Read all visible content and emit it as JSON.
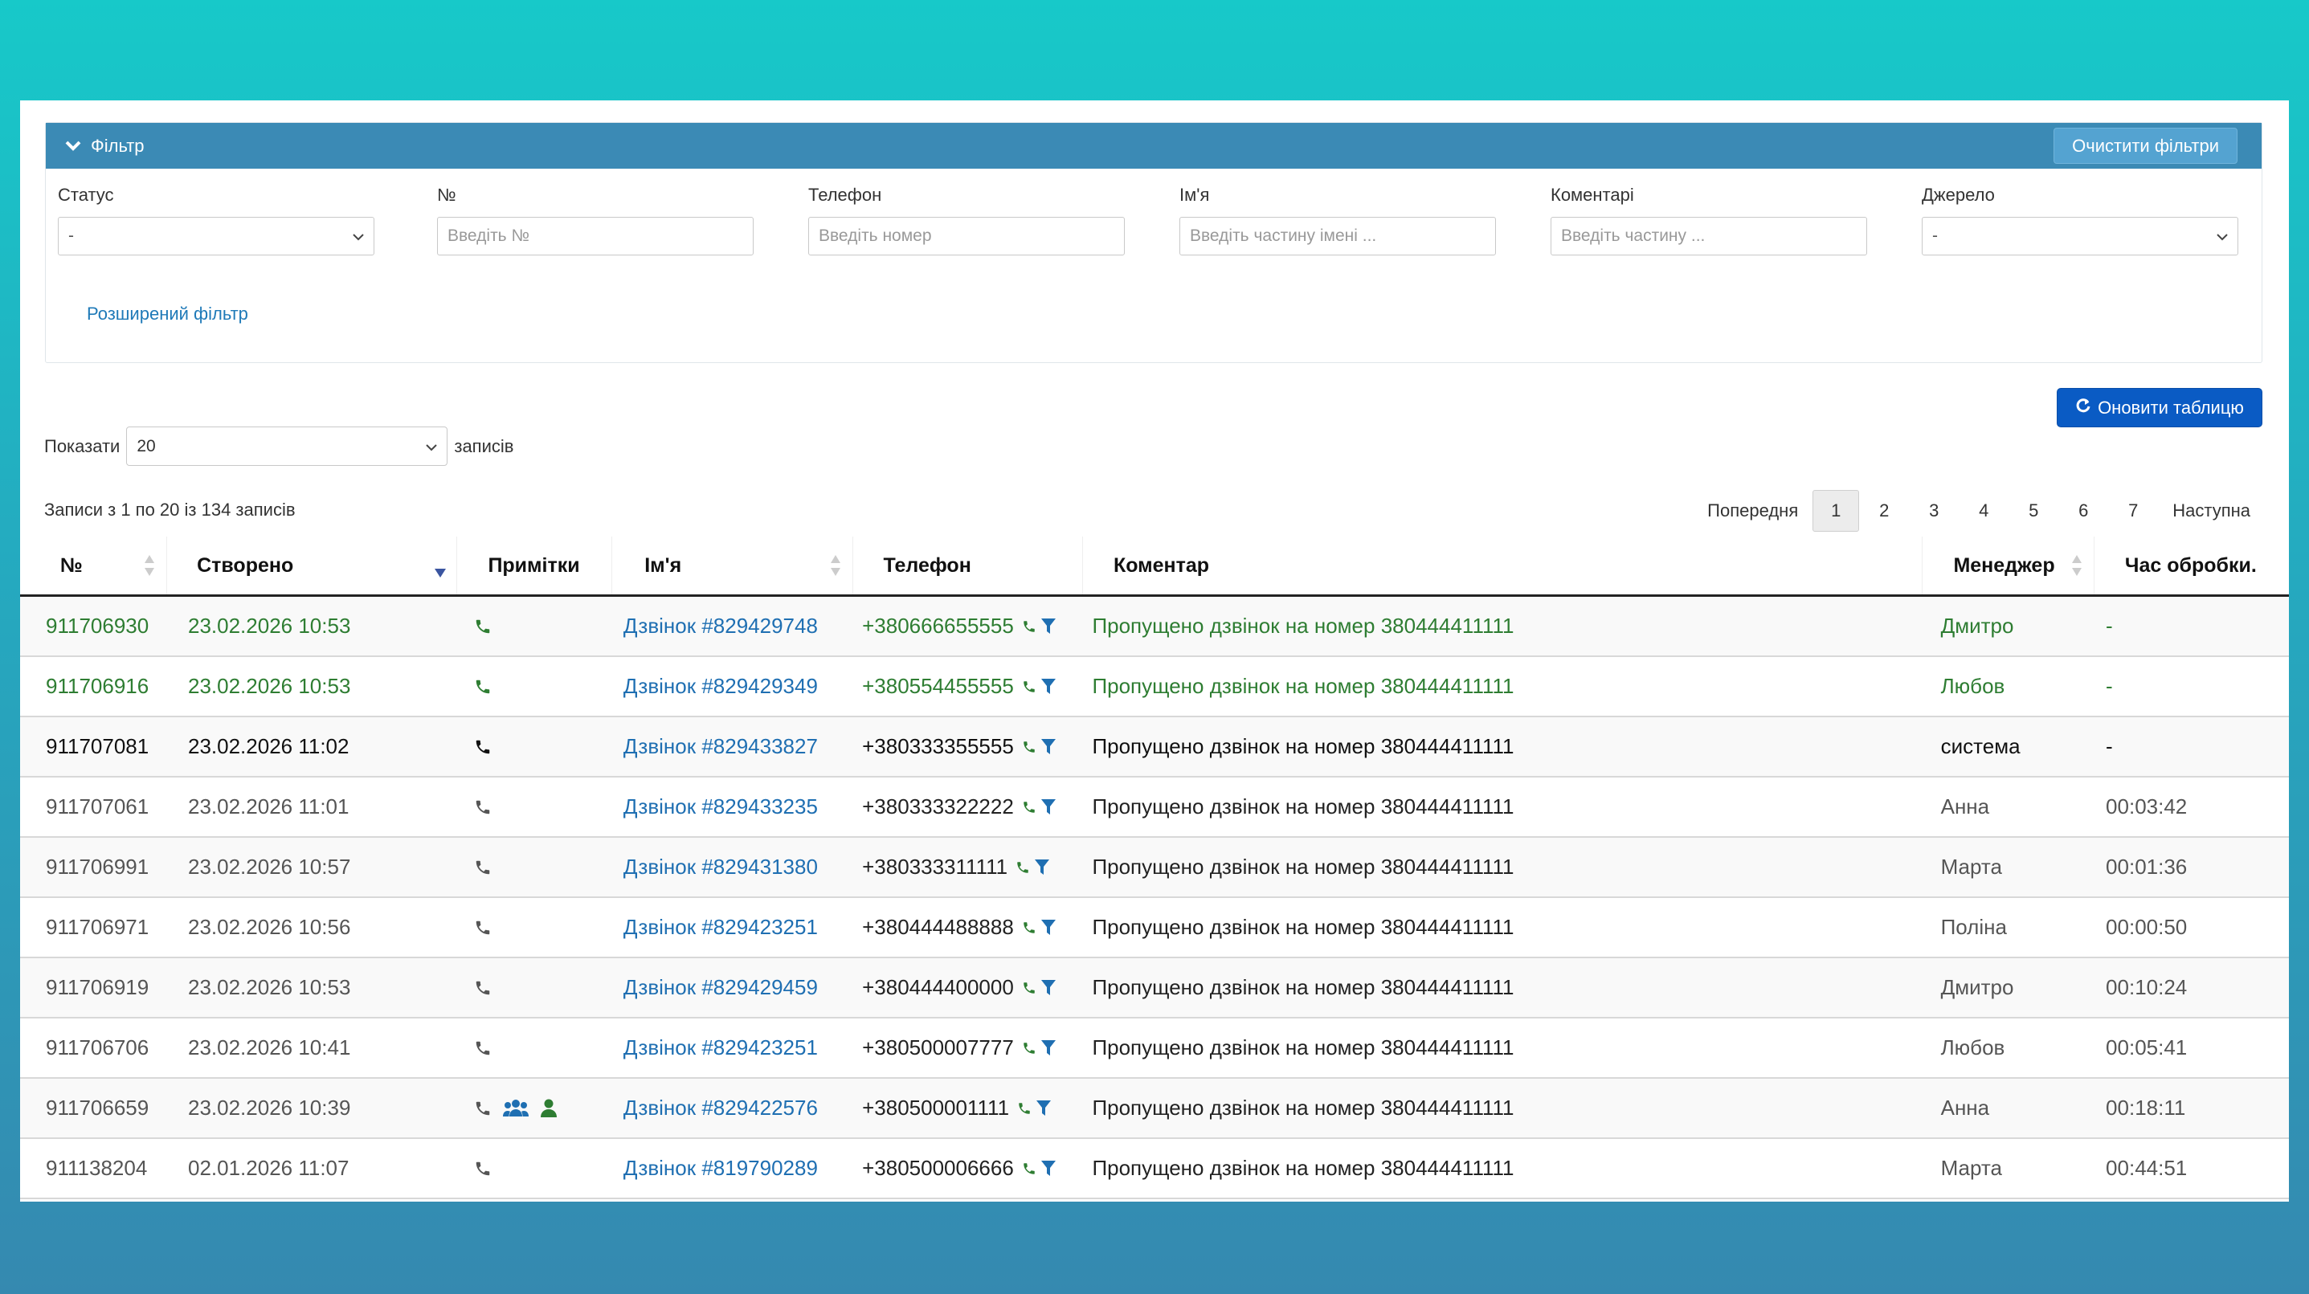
{
  "filter": {
    "title": "Фільтр",
    "clear_label": "Очистити фільтри",
    "fields": [
      {
        "label": "Статус",
        "value": "-",
        "placeholder": ""
      },
      {
        "label": "№",
        "value": "",
        "placeholder": "Введіть №"
      },
      {
        "label": "Телефон",
        "value": "",
        "placeholder": "Введіть номер"
      },
      {
        "label": "Ім'я",
        "value": "",
        "placeholder": "Введіть частину імені ..."
      },
      {
        "label": "Коментарі",
        "value": "",
        "placeholder": "Введіть частину ..."
      },
      {
        "label": "Джерело",
        "value": "-",
        "placeholder": ""
      }
    ],
    "advanced_label": "Розширений фільтр"
  },
  "toolbar": {
    "refresh_label": "Оновити таблицю",
    "show_prefix": "Показати",
    "show_value": "20",
    "show_suffix": "записів",
    "info": "Записи з 1 по 20 із 134 записів"
  },
  "pagination": {
    "prev": "Попередня",
    "pages": [
      "1",
      "2",
      "3",
      "4",
      "5",
      "6",
      "7"
    ],
    "active": "1",
    "next": "Наступна"
  },
  "table": {
    "columns": [
      "№",
      "Створено",
      "Примітки",
      "Ім'я",
      "Телефон",
      "Коментар",
      "Менеджер",
      "Час обробки."
    ],
    "rows": [
      {
        "id": "911706930",
        "created": "23.02.2026 10:53",
        "name": "Дзвінок #829429748",
        "phone": "+380666655555",
        "comment": "Пропущено дзвінок на номер 380444411111",
        "manager": "Дмитро",
        "time": "-",
        "style": "green",
        "extra_icons": false
      },
      {
        "id": "911706916",
        "created": "23.02.2026 10:53",
        "name": "Дзвінок #829429349",
        "phone": "+380554455555",
        "comment": "Пропущено дзвінок на номер 380444411111",
        "manager": "Любов",
        "time": "-",
        "style": "green",
        "extra_icons": false
      },
      {
        "id": "911707081",
        "created": "23.02.2026 11:02",
        "name": "Дзвінок #829433827",
        "phone": "+380333355555",
        "comment": "Пропущено дзвінок на номер 380444411111",
        "manager": "система",
        "time": "-",
        "style": "black",
        "extra_icons": false
      },
      {
        "id": "911707061",
        "created": "23.02.2026 11:01",
        "name": "Дзвінок #829433235",
        "phone": "+380333322222",
        "comment": "Пропущено дзвінок на номер 380444411111",
        "manager": "Анна",
        "time": "00:03:42",
        "style": "gray",
        "extra_icons": false
      },
      {
        "id": "911706991",
        "created": "23.02.2026 10:57",
        "name": "Дзвінок #829431380",
        "phone": "+380333311111",
        "comment": "Пропущено дзвінок на номер 380444411111",
        "manager": "Марта",
        "time": "00:01:36",
        "style": "gray",
        "extra_icons": false
      },
      {
        "id": "911706971",
        "created": "23.02.2026 10:56",
        "name": "Дзвінок #829423251",
        "phone": "+380444488888",
        "comment": "Пропущено дзвінок на номер 380444411111",
        "manager": "Поліна",
        "time": "00:00:50",
        "style": "gray",
        "extra_icons": false
      },
      {
        "id": "911706919",
        "created": "23.02.2026 10:53",
        "name": "Дзвінок #829429459",
        "phone": "+380444400000",
        "comment": "Пропущено дзвінок на номер 380444411111",
        "manager": "Дмитро",
        "time": "00:10:24",
        "style": "gray",
        "extra_icons": false
      },
      {
        "id": "911706706",
        "created": "23.02.2026 10:41",
        "name": "Дзвінок #829423251",
        "phone": "+380500007777",
        "comment": "Пропущено дзвінок на номер 380444411111",
        "manager": "Любов",
        "time": "00:05:41",
        "style": "gray",
        "extra_icons": false
      },
      {
        "id": "911706659",
        "created": "23.02.2026 10:39",
        "name": "Дзвінок #829422576",
        "phone": "+380500001111",
        "comment": "Пропущено дзвінок на номер 380444411111",
        "manager": "Анна",
        "time": "00:18:11",
        "style": "gray",
        "extra_icons": true
      },
      {
        "id": "911138204",
        "created": "02.01.2026 11:07",
        "name": "Дзвінок #819790289",
        "phone": "+380500006666",
        "comment": "Пропущено дзвінок на номер 380444411111",
        "manager": "Марта",
        "time": "00:44:51",
        "style": "gray",
        "extra_icons": false
      }
    ]
  },
  "colors": {
    "header_bar": "#3b8ab5",
    "refresh_button": "#0a5bc4",
    "link": "#1f6fb2",
    "green_row": "#2e7d32"
  },
  "icons": [
    "chevron-down-icon",
    "phone-icon",
    "filter-icon",
    "group-icon",
    "user-icon",
    "refresh-icon",
    "sort-icon"
  ]
}
